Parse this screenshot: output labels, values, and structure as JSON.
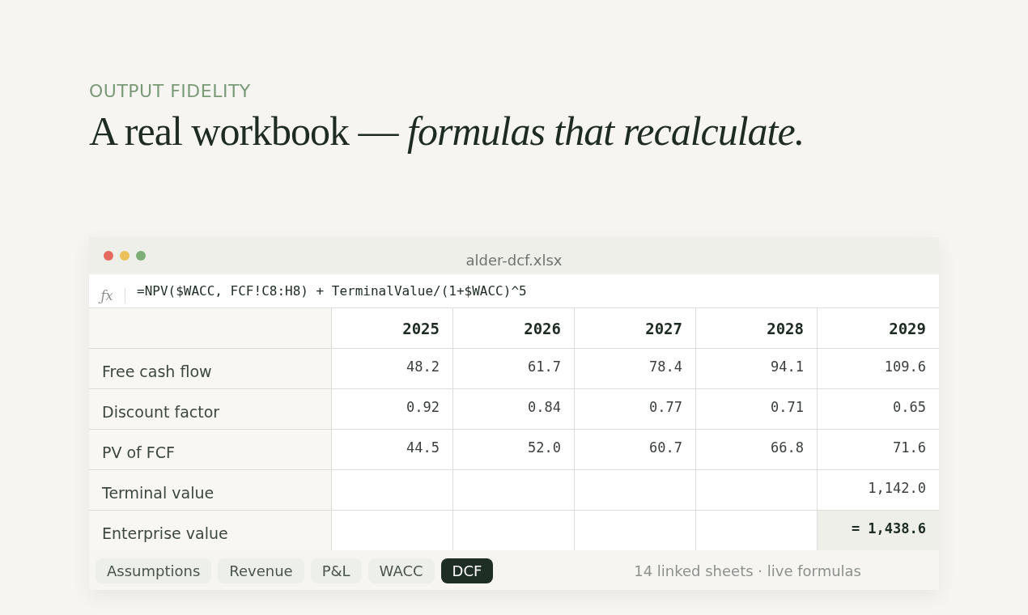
{
  "eyebrow": "OUTPUT FIDELITY",
  "headline": "A real workbook — *formulas that recalculate.*",
  "window": {
    "title": "alder-dcf.xlsx"
  },
  "formula_bar": {
    "icon_text": "ƒx",
    "formula": "=NPV($WACC, FCF!C8:H8) + TerminalValue/(1+$WACC)^5"
  },
  "table": {
    "columns": [
      "2025",
      "2026",
      "2027",
      "2028",
      "2029"
    ],
    "rows": [
      {
        "label": "Free cash flow",
        "values": [
          "48.2",
          "61.7",
          "78.4",
          "94.1",
          "109.6"
        ],
        "highlighted": false
      },
      {
        "label": "Discount factor",
        "values": [
          "0.92",
          "0.84",
          "0.77",
          "0.71",
          "0.65"
        ],
        "highlighted": false
      },
      {
        "label": "PV of FCF",
        "values": [
          "44.5",
          "52.0",
          "60.7",
          "66.8",
          "71.6"
        ],
        "highlighted": false
      },
      {
        "label": "Terminal value",
        "values": [
          "1,142.0"
        ],
        "highlighted": false
      },
      {
        "label": "Enterprise value",
        "values": [
          "= 1,438.6"
        ],
        "highlighted": true
      }
    ]
  },
  "sheet_tabs": [
    {
      "label": "Assumptions",
      "selected": false
    },
    {
      "label": "Revenue",
      "selected": false
    },
    {
      "label": "P&L",
      "selected": false
    },
    {
      "label": "WACC",
      "selected": false
    },
    {
      "label": "DCF",
      "selected": true
    }
  ],
  "footer_note": "14 linked sheets · live formulas"
}
